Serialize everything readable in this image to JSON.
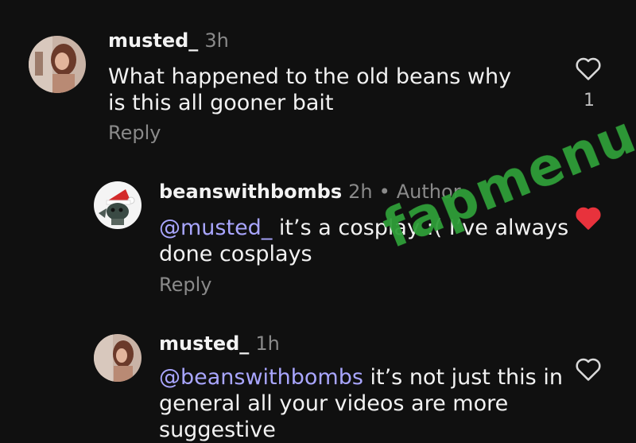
{
  "comments": [
    {
      "username": "musted_",
      "time": "3h",
      "text": "What happened to the old beans why is this all gooner bait",
      "reply_label": "Reply",
      "like_count": "1",
      "liked": false
    },
    {
      "username": "beanswithbombs",
      "time": "2h",
      "badge": "Author",
      "mention": "@musted_",
      "text": " it’s a cosplay :( I’ve always done cosplays",
      "reply_label": "Reply",
      "liked": true
    },
    {
      "username": "musted_",
      "time": "1h",
      "mention": "@beanswithbombs",
      "text": " it’s not just this in general all your videos are more suggestive",
      "liked": false
    }
  ],
  "watermark": "fapmenu.com",
  "colors": {
    "background": "#101010",
    "mention": "#a9a6ff",
    "heart_liked": "#e8323c",
    "watermark": "#2f9e38"
  }
}
